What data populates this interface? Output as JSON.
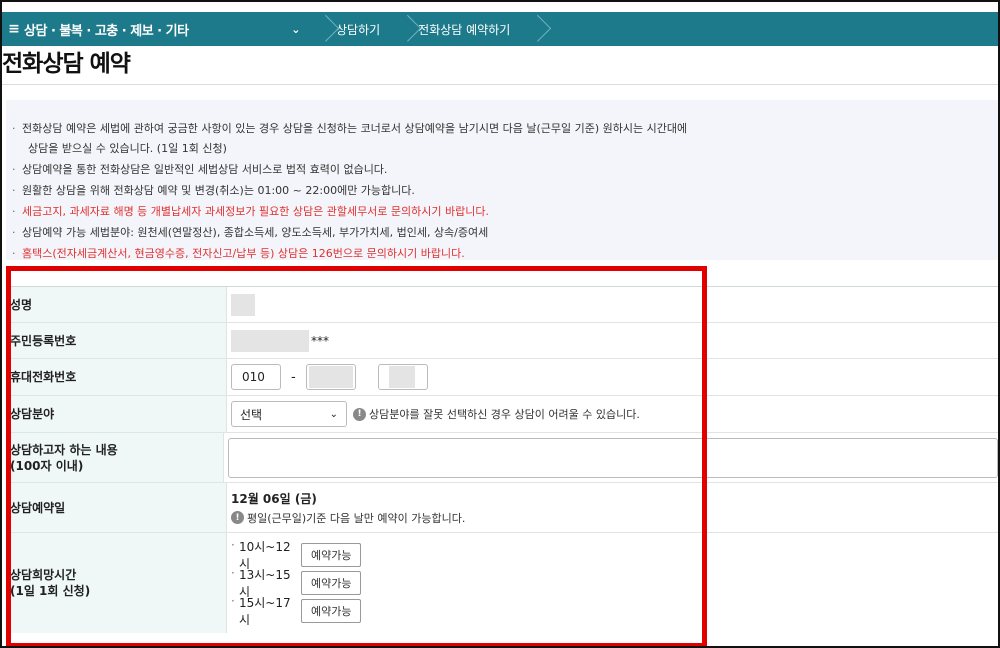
{
  "nav": {
    "menu_icon": "≡",
    "category": "상담 · 불복 · 고충 · 제보 · 기타",
    "chevron": "⌄",
    "crumb2": "상담하기",
    "crumb3": "전화상담 예약하기"
  },
  "page": {
    "title": "전화상담 예약"
  },
  "notice": {
    "line1": "전화상담 예약은 세법에 관하여 궁금한 사항이 있는 경우 상담을 신청하는 코너로서 상담예약을 남기시면 다음 날(근무일 기준) 원하시는 시간대에",
    "line1b": "상담을 받으실 수 있습니다. (1일 1회 신청)",
    "line2": "상담예약을 통한 전화상담은 일반적인 세법상담 서비스로 법적 효력이 없습니다.",
    "line3": "원활한 상담을 위해 전화상담 예약 및 변경(취소)는 01:00 ~ 22:00에만 가능합니다.",
    "line4": "세금고지, 과세자료 해명 등 개별납세자 과세정보가 필요한 상담은 관할세무서로 문의하시기 바랍니다.",
    "line5": "상담예약 가능 세법분야: 원천세(연말정산), 종합소득세, 양도소득세, 부가가치세, 법인세, 상속/증여세",
    "line6": "홈택스(전자세금계산서, 현금영수증, 전자신고/납부 등) 상담은 126번으로 문의하시기 바랍니다."
  },
  "form": {
    "name_label": "성명",
    "rrn_label": "주민등록번호",
    "rrn_suffix": "***",
    "phone_label": "휴대전화번호",
    "phone_prefix": "010",
    "phone_dash": "-",
    "field_label": "상담분야",
    "field_value": "선택",
    "field_hint": "상담분야를 잘못 선택하신 경우 상담이 어려울 수 있습니다.",
    "content_label_1": "상담하고자 하는 내용",
    "content_label_2": "(100자 이내)",
    "date_label": "상담예약일",
    "date_value": "12월 06일 (금)",
    "date_hint": "평일(근무일)기준 다음 날만 예약이 가능합니다.",
    "time_label_1": "상담희망시간",
    "time_label_2": "(1일 1회 신청)",
    "slots": [
      {
        "time": "10시~12시",
        "button": "예약가능"
      },
      {
        "time": "13시~15시",
        "button": "예약가능"
      },
      {
        "time": "15시~17시",
        "button": "예약가능"
      }
    ]
  },
  "colors": {
    "nav": "#1d7a8a",
    "highlight_box": "#e00000",
    "warning_text": "#e03030"
  }
}
